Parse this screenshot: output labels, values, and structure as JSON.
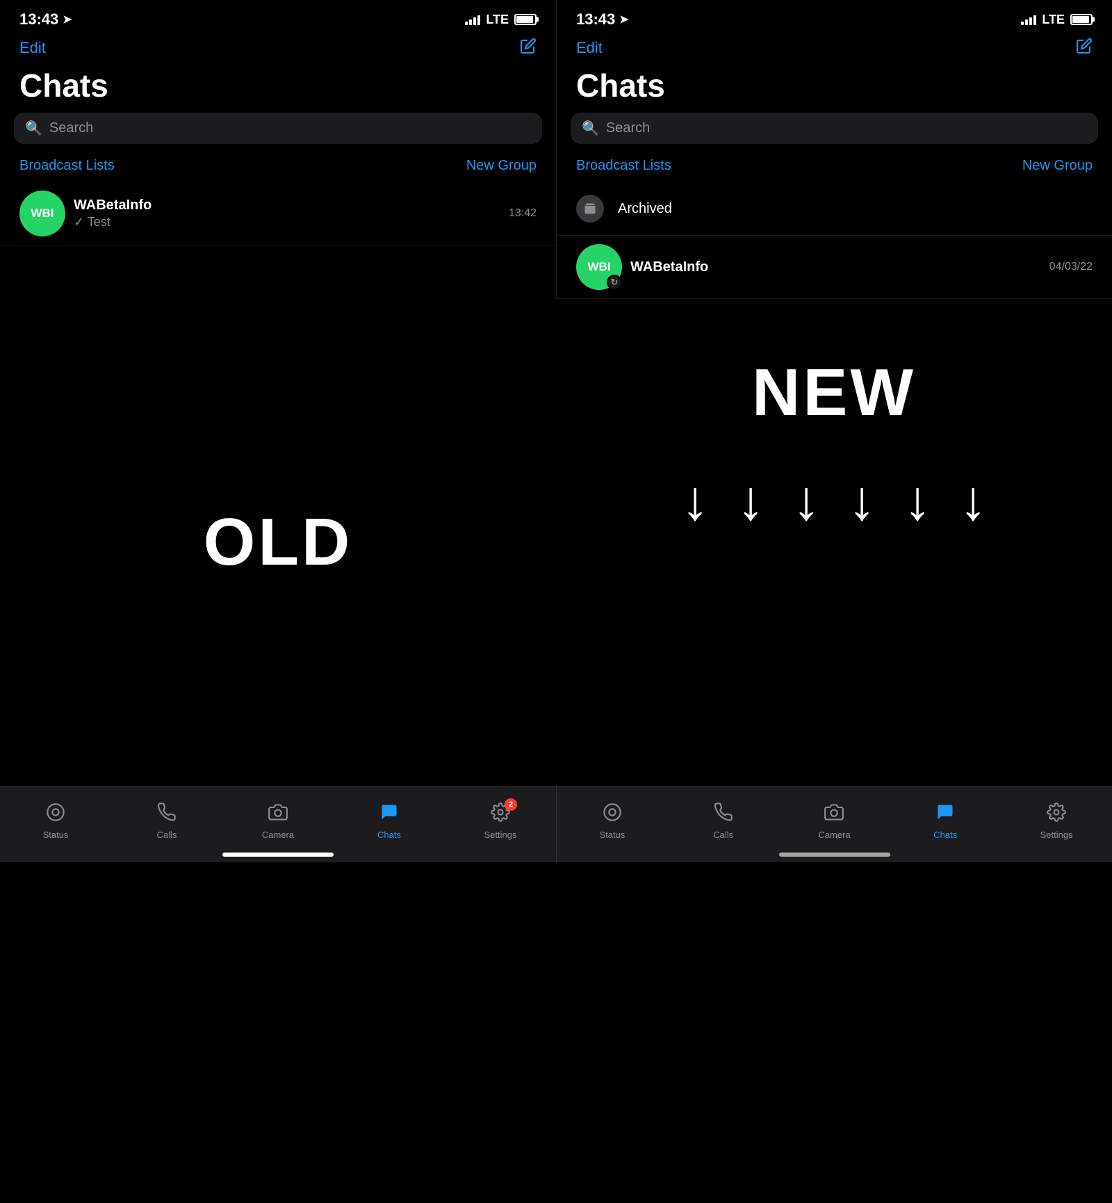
{
  "phones": [
    {
      "id": "left",
      "statusBar": {
        "time": "13:43",
        "lte": "LTE"
      },
      "header": {
        "editLabel": "Edit",
        "composeSymbol": "⊹"
      },
      "title": "Chats",
      "searchPlaceholder": "Search",
      "broadcastLabel": "Broadcast Lists",
      "newGroupLabel": "New Group",
      "chats": [
        {
          "name": "WABetaInfo",
          "avatar": "WBI",
          "preview": "✓ Test",
          "time": "13:42",
          "hasSync": false
        }
      ],
      "showArchived": false
    },
    {
      "id": "right",
      "statusBar": {
        "time": "13:43",
        "lte": "LTE"
      },
      "header": {
        "editLabel": "Edit",
        "composeSymbol": "⊹"
      },
      "title": "Chats",
      "searchPlaceholder": "Search",
      "broadcastLabel": "Broadcast Lists",
      "newGroupLabel": "New Group",
      "chats": [
        {
          "name": "WABetaInfo",
          "avatar": "WBI",
          "preview": "",
          "time": "04/03/22",
          "hasSync": true
        }
      ],
      "showArchived": true,
      "archivedLabel": "Archived"
    }
  ],
  "labels": {
    "old": "OLD",
    "new": "NEW"
  },
  "arrows": [
    "↓",
    "↓",
    "↓",
    "↓",
    "↓",
    "↓"
  ],
  "tabBars": [
    {
      "items": [
        {
          "icon": "status-icon",
          "label": "Status",
          "active": false
        },
        {
          "icon": "calls-icon",
          "label": "Calls",
          "active": false
        },
        {
          "icon": "camera-icon",
          "label": "Camera",
          "active": false
        },
        {
          "icon": "chats-icon",
          "label": "Chats",
          "active": true
        },
        {
          "icon": "settings-icon",
          "label": "Settings",
          "active": false,
          "badge": "2"
        }
      ]
    },
    {
      "items": [
        {
          "icon": "status-icon",
          "label": "Status",
          "active": false
        },
        {
          "icon": "calls-icon",
          "label": "Calls",
          "active": false
        },
        {
          "icon": "camera-icon",
          "label": "Camera",
          "active": false
        },
        {
          "icon": "chats-icon",
          "label": "Chats",
          "active": true
        },
        {
          "icon": "settings-icon",
          "label": "Settings",
          "active": false
        }
      ]
    }
  ]
}
